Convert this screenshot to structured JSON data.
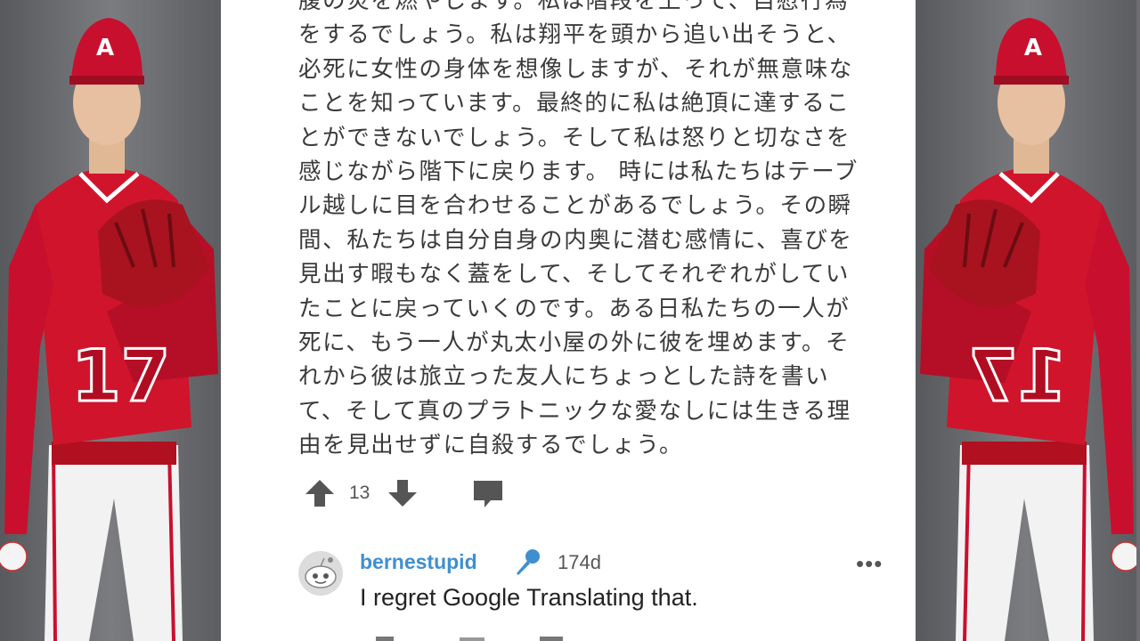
{
  "post": {
    "body_lines": [
      "腹の炎を燃やします。私は階段を上って、自慰行為",
      "をするでしょう。私は翔平を頭から追い出そうと、",
      "必死に女性の身体を想像しますが、それが無意味な",
      "ことを知っています。最終的に私は絶頂に達するこ",
      "とができないでしょう。そして私は怒りと切なさを",
      "感じながら階下に戻ります。 時には私たちはテーブ",
      "ル越しに目を合わせることがあるでしょう。その瞬",
      "間、私たちは自分自身の内奥に潜む感情に、喜びを",
      "見出す暇もなく蓋をして、そしてそれぞれがしてい",
      "たことに戻っていくのです。ある日私たちの一人が",
      "死に、もう一人が丸太小屋の外に彼を埋めます。そ",
      "れから彼は旅立った友人にちょっとした詩を書い",
      "て、そして真のプラトニックな愛なしには生きる理",
      "由を見出せずに自殺するでしょう。"
    ],
    "vote_count": "13",
    "icons": [
      "upvote-arrow-icon",
      "downvote-arrow-icon",
      "comment-bubble-icon"
    ]
  },
  "reply": {
    "username": "bernestupid",
    "age": "174d",
    "more_label": "•••",
    "text": "I regret Google Translating that.",
    "icons": [
      "snoo-avatar-icon",
      "microphone-icon",
      "more-options-icon"
    ]
  },
  "colors": {
    "username": "#3f8fcf",
    "jersey_red": "#c8102e",
    "background_gray": "#6c6d70"
  }
}
